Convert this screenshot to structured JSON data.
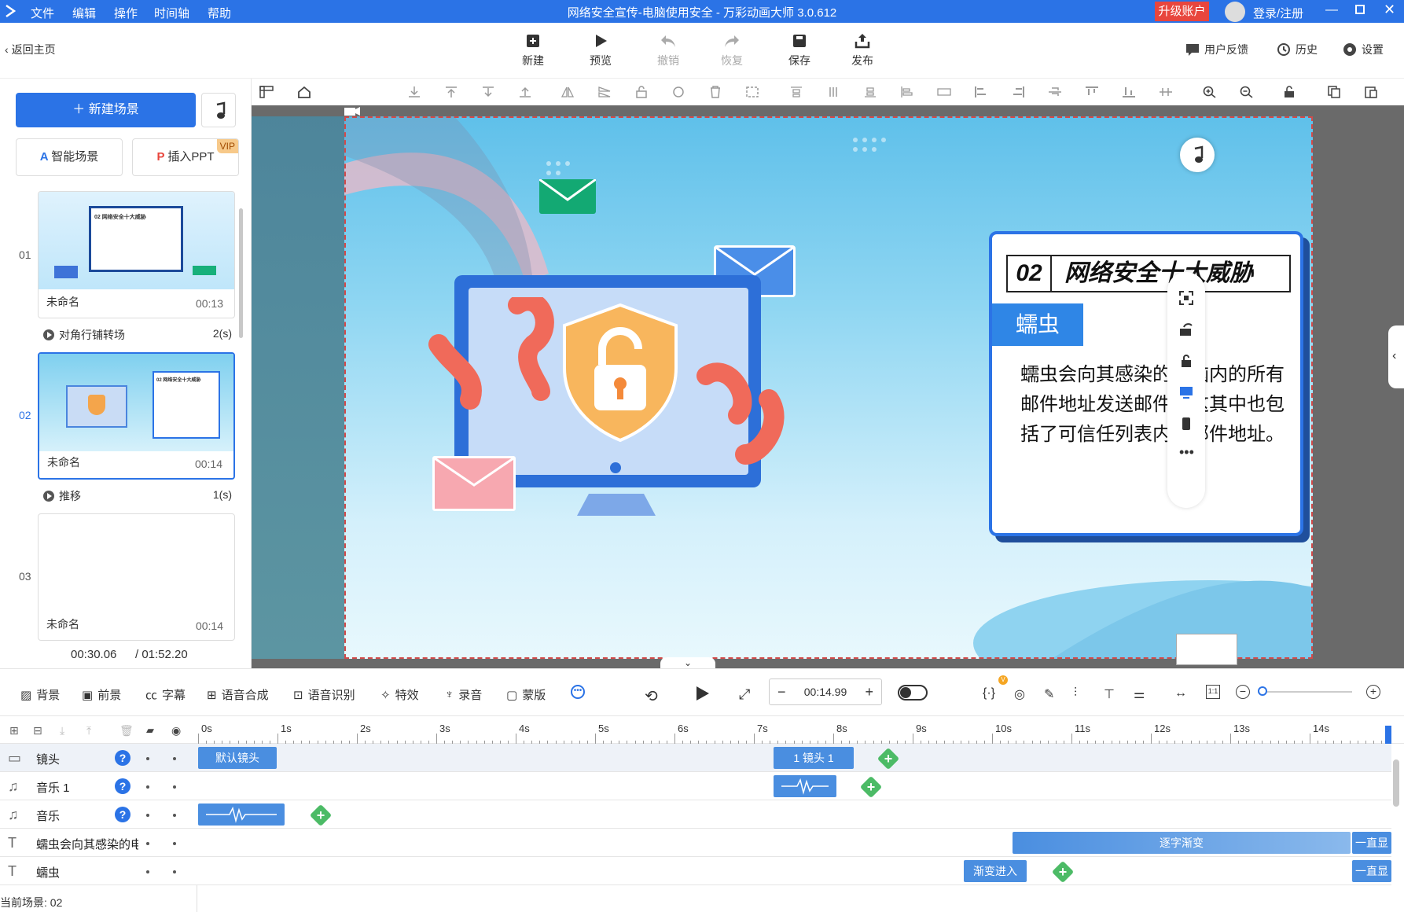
{
  "titlebar": {
    "menu": [
      "文件",
      "编辑",
      "操作",
      "时间轴",
      "帮助"
    ],
    "title": "网络安全宣传-电脑使用安全 - 万彩动画大师 3.0.612",
    "upgrade": "升级账户",
    "login": "登录/注册"
  },
  "toolbar": {
    "back": "返回主页",
    "buttons": [
      "新建",
      "预览",
      "撤销",
      "恢复",
      "保存",
      "发布"
    ],
    "feedback": "用户反馈",
    "history": "历史",
    "settings": "设置"
  },
  "left": {
    "new_scene": "新建场景",
    "smart_scene": "智能场景",
    "insert_ppt": "插入PPT",
    "vip": "VIP",
    "scenes": [
      {
        "num": "01",
        "name": "未命名",
        "duration": "00:13"
      },
      {
        "num": "02",
        "name": "未命名",
        "duration": "00:14"
      },
      {
        "num": "03",
        "name": "未命名",
        "duration": "00:14"
      }
    ],
    "transitions": [
      {
        "name": "对角行铺转场",
        "duration": "2(s)"
      },
      {
        "name": "推移",
        "duration": "1(s)"
      }
    ],
    "current_time": "00:30.06",
    "total_time": "/ 01:52.20",
    "thumb1_title": "02 网络安全十大威胁",
    "thumb2_title": "02 网络安全十大威胁"
  },
  "canvas": {
    "heading_num": "02",
    "heading": "网络安全十大威胁",
    "tag": "蠕虫",
    "body": "蠕虫会向其感染的电脑内的所有邮件地址发送邮件，这其中也包括了可信任列表内的邮件地址。"
  },
  "bottom": {
    "tools": [
      "背景",
      "前景",
      "字幕",
      "语音合成",
      "语音识别",
      "特效",
      "录音",
      "蒙版"
    ],
    "time_value": "00:14.99",
    "ruler": [
      "0s",
      "1s",
      "2s",
      "3s",
      "4s",
      "5s",
      "6s",
      "7s",
      "8s",
      "9s",
      "10s",
      "11s",
      "12s",
      "13s",
      "14s"
    ],
    "tracks": [
      {
        "icon": "camera-icon",
        "label": "镜头",
        "help": "?"
      },
      {
        "icon": "music-icon",
        "label": "音乐 1",
        "help": "?"
      },
      {
        "icon": "music-icon",
        "label": "音乐",
        "help": "?"
      },
      {
        "icon": "text-icon",
        "label": "蠕虫会向其感染的电"
      },
      {
        "icon": "text-icon",
        "label": "蠕虫"
      }
    ],
    "clips": {
      "default_camera": "默认镜头",
      "camera1": "1 镜头 1",
      "typewriter": "逐字渐变",
      "fadein": "渐变进入",
      "always1": "一直显",
      "always2": "一直显"
    },
    "current_scene": "当前场景: 02"
  },
  "colors": {
    "accent": "#2b73e6",
    "upgrade": "#e8463d",
    "add": "#4cbb66"
  }
}
